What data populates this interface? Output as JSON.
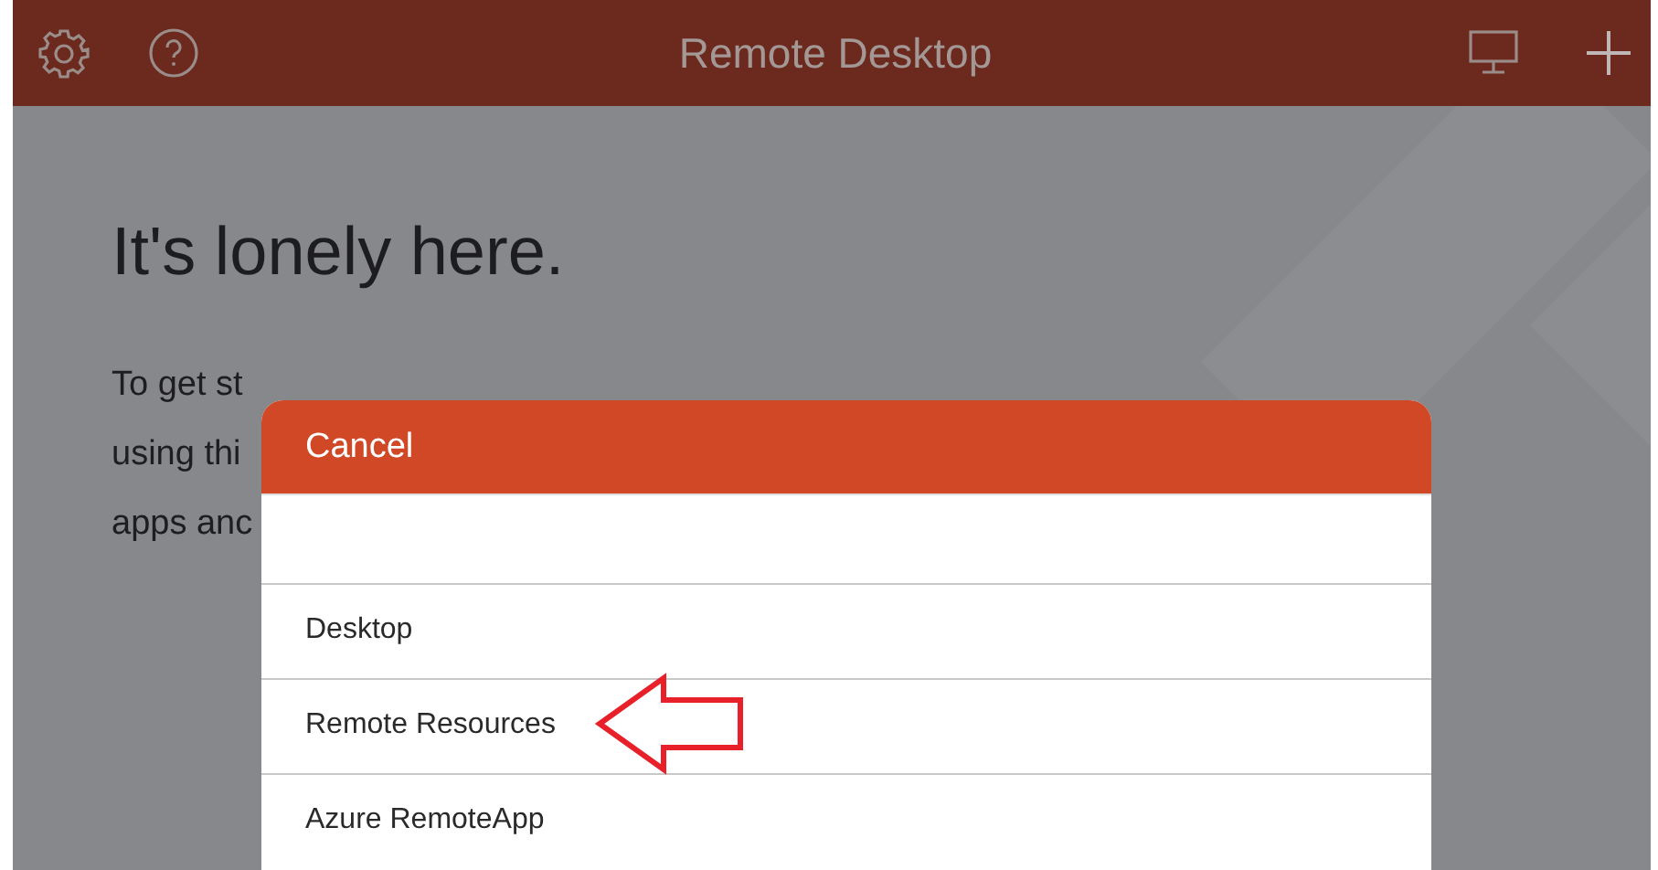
{
  "header": {
    "title": "Remote Desktop"
  },
  "empty_state": {
    "heading": "It's lonely here.",
    "lines": [
      "To get st",
      "using thi",
      "apps anc"
    ]
  },
  "sheet": {
    "cancel": "Cancel",
    "options": [
      {
        "label": "Desktop"
      },
      {
        "label": "Remote Resources"
      },
      {
        "label": "Azure RemoteApp"
      }
    ]
  }
}
